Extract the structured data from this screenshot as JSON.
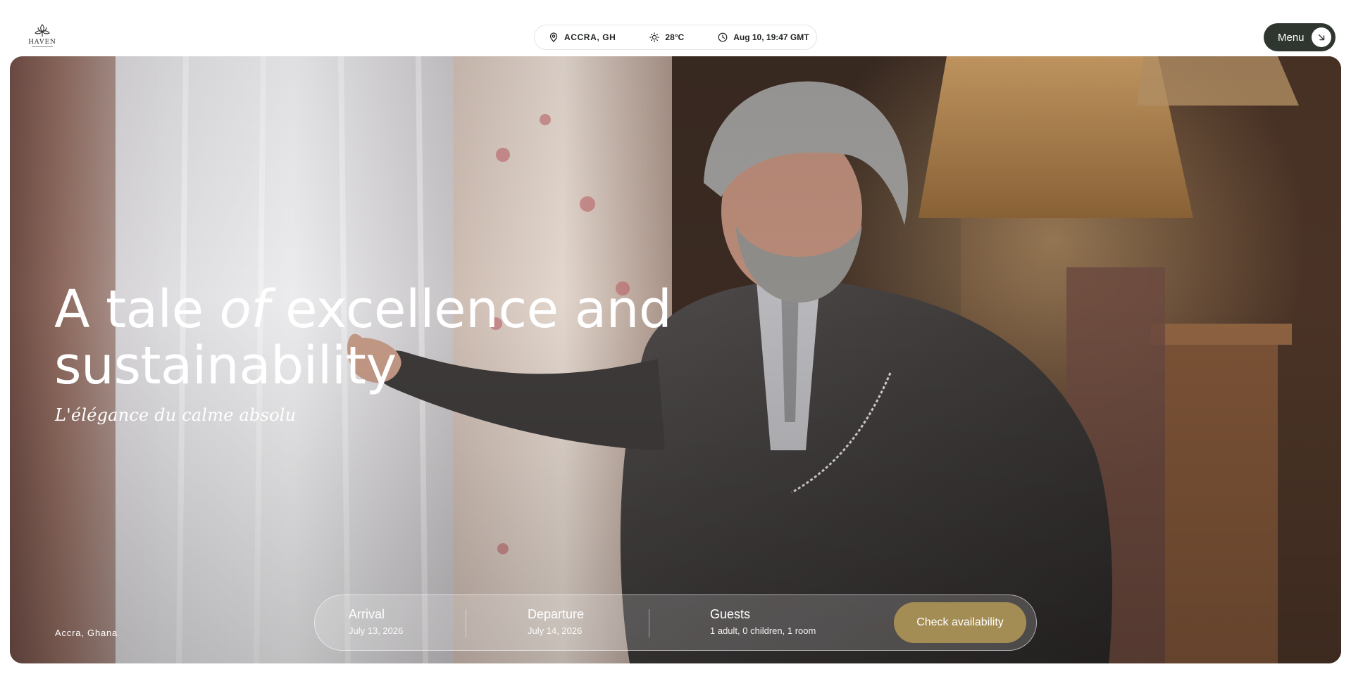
{
  "brand": {
    "name": "HAVEN",
    "logo_icon": "haven-flower-logo"
  },
  "info_bar": {
    "location": "ACCRA, GH",
    "location_icon": "map-pin-icon",
    "temperature": "28°C",
    "weather_icon": "sun-icon",
    "datetime": "Aug 10, 19:47 GMT",
    "time_icon": "clock-icon"
  },
  "menu": {
    "label": "Menu",
    "icon": "arrow-down-right-icon"
  },
  "hero": {
    "title_part1": "A tale ",
    "title_italic": "of",
    "title_part2": " excellence and sustainability",
    "tagline": "L'élégance du calme absolu",
    "location": "Accra, Ghana"
  },
  "booking": {
    "arrival_label": "Arrival",
    "arrival_value": "July 13, 2026",
    "departure_label": "Departure",
    "departure_value": "July 14, 2026",
    "guests_label": "Guests",
    "guests_value": "1 adult, 0 children, 1 room",
    "cta": "Check availability"
  },
  "colors": {
    "menu_bg": "#2f362f",
    "cta_bg": "#a48d55",
    "text_dark": "#1f2320",
    "text_light": "#ffffff"
  }
}
